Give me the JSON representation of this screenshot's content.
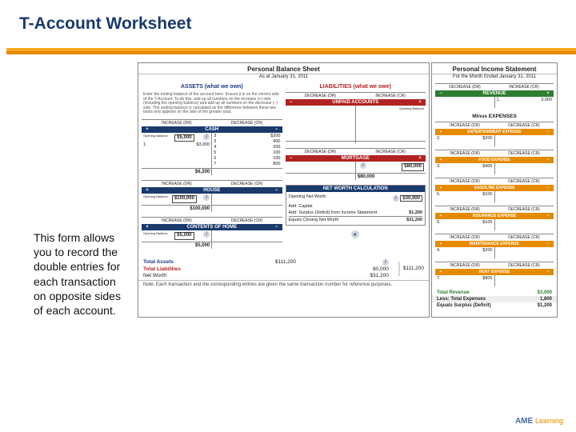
{
  "title": "T-Account Worksheet",
  "description": "This form allows you to record the double entries for each transaction on opposite sides of each account.",
  "balance_sheet": {
    "title": "Personal Balance Sheet",
    "subtitle": "As at January 31, 2011",
    "assets_header": "ASSETS (what we own)",
    "liab_header": "LIABILITIES (what we owe)",
    "dr_increase": "INCREASE (DR)",
    "cr_decrease": "DECREASE (CR)",
    "dr_decrease": "DECREASE (DR)",
    "cr_increase": "INCREASE (CR)",
    "instructions": "Enter the ending balance of the account here. Ensure it is on the correct side of the T-Account. To do this, add up all numbers on the increase (+) side (including the opening balance) and add up all numbers on the decrease (−) side. The ending balance is calculated as the difference between these two totals and appears on the side of the greater total.",
    "cash": {
      "name": "CASH",
      "opening": "$5,000",
      "line1_no": "1.",
      "line1_val": "$3,000",
      "r2n": "3",
      "r2v": "$200",
      "r3n": "3",
      "r3v": "400",
      "r4n": "4",
      "r4v": "200",
      "r5n": "5",
      "r5v": "100",
      "r6n": "6",
      "r6v": "100",
      "r7n": "7",
      "r7v": "800",
      "total": "$6,200"
    },
    "house": {
      "name": "HOUSE",
      "opening": "$100,000",
      "total": "$100,000"
    },
    "contents": {
      "name": "CONTENTS OF HOME",
      "opening": "$5,000",
      "total": "$5,000"
    },
    "unpaid": {
      "name": "UNPAID ACCOUNTS"
    },
    "mortgage": {
      "name": "MORTGAGE",
      "opening": "$80,000",
      "total": "$80,000"
    },
    "networth": {
      "title": "NET WORTH CALCULATION",
      "open_label": "Opening Net Worth",
      "open_val": "$30,000",
      "addcap_label": "Add: Capital",
      "surplus_label": "Add: Surplus (Deficit) from Income Statement",
      "surplus_val": "$1,200",
      "closing_label": "Equals Closing Net Worth",
      "closing_val": "$31,200"
    },
    "summary": {
      "total_assets_label": "Total Assets",
      "total_assets_val": "$111,200",
      "total_liab_label": "Total Liabilities",
      "total_liab_val": "80,000",
      "networth_label": "Net Worth",
      "networth_val": "$31,200",
      "combined": "$111,200"
    },
    "note": "Note: Each transaction and the corresponding entries are given the same transaction number for reference purposes."
  },
  "income_statement": {
    "title": "Personal Income Statement",
    "subtitle": "For the Month Ended January 31, 2011",
    "decrease_dr": "DECREASE (DR)",
    "increase_cr": "INCREASE (CR)",
    "increase_dr": "INCREASE (DR)",
    "decrease_cr": "DECREASE (CR)",
    "revenue": {
      "name": "REVENUE",
      "no": "1.",
      "val": "3,000"
    },
    "minus_label": "Minus EXPENSES",
    "ent": {
      "name": "ENTERTAINMENT EXPENSE",
      "no": "2.",
      "val": "$200"
    },
    "food": {
      "name": "FOOD EXPENSE",
      "no": "3.",
      "val": "$400"
    },
    "gas": {
      "name": "GASOLINE EXPENSE",
      "no": "6.",
      "val": "$100"
    },
    "ins": {
      "name": "INSURANCE EXPENSE",
      "no": "5.",
      "val": "$100"
    },
    "maint": {
      "name": "MAINTENANCE EXPENSE",
      "no": "4.",
      "val": "$200"
    },
    "rent": {
      "name": "RENT EXPENSE",
      "no": "7.",
      "val": "$800"
    },
    "total_rev_label": "Total Revenue",
    "total_rev_val": "$3,000",
    "less_exp_label": "Less: Total Expenses",
    "less_exp_val": "1,800",
    "surplus_label": "Equals Surplus (Deficit)",
    "surplus_val": "$1,200"
  },
  "opening_balance_label": "Opening Balance",
  "footer": {
    "brand": "AME",
    "sub": "Learning"
  }
}
